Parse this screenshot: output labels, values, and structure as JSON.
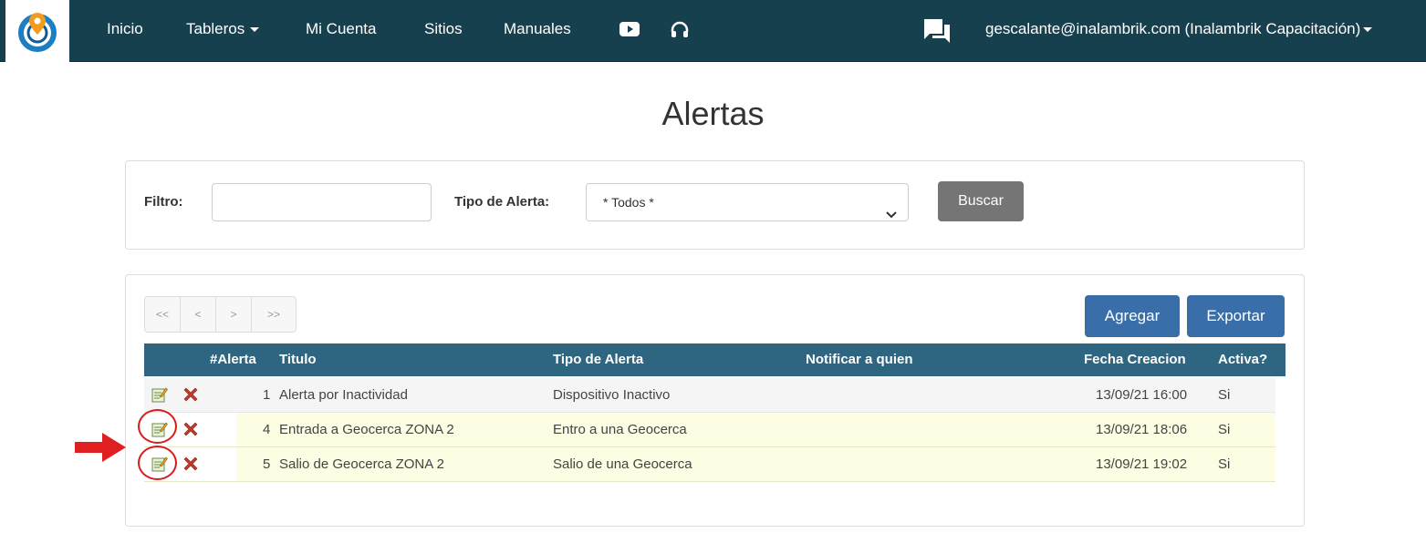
{
  "nav": {
    "items": [
      {
        "label": "Inicio"
      },
      {
        "label": "Tableros"
      },
      {
        "label": "Mi Cuenta"
      },
      {
        "label": "Sitios"
      },
      {
        "label": "Manuales"
      }
    ],
    "icons": [
      "logo-icon",
      "youtube-icon",
      "headset-icon",
      "chat-icon"
    ],
    "user": "gescalante@inalambrik.com (Inalambrik Capacitación)",
    "bar_color": "#17404f"
  },
  "page": {
    "title": "Alertas"
  },
  "filter": {
    "filter_label": "Filtro:",
    "filter_value": "",
    "type_label": "Tipo de Alerta:",
    "type_selected": "* Todos *",
    "search_button": "Buscar"
  },
  "pager": {
    "first": "<<",
    "prev": "<",
    "next": ">",
    "last": ">>"
  },
  "actions": {
    "add": "Agregar",
    "export": "Exportar"
  },
  "table": {
    "headers": [
      "#Alerta",
      "Titulo",
      "Tipo de Alerta",
      "Notificar a quien",
      "Fecha Creacion",
      "Activa?"
    ],
    "rows": [
      {
        "id": "1",
        "title": "Alerta por Inactividad",
        "type": "Dispositivo Inactivo",
        "notify": "",
        "date": "13/09/21 16:00",
        "active": "Si"
      },
      {
        "id": "4",
        "title": "Entrada a Geocerca ZONA 2",
        "type": "Entro a una Geocerca",
        "notify": "",
        "date": "13/09/21 18:06",
        "active": "Si"
      },
      {
        "id": "5",
        "title": "Salio de Geocerca ZONA 2",
        "type": "Salio de una Geocerca",
        "notify": "",
        "date": "13/09/21 19:02",
        "active": "Si"
      }
    ],
    "header_color": "#2e6580",
    "highlight_color": "#fdfde3"
  },
  "annotations": {
    "marker_color": "#d71a1a"
  }
}
